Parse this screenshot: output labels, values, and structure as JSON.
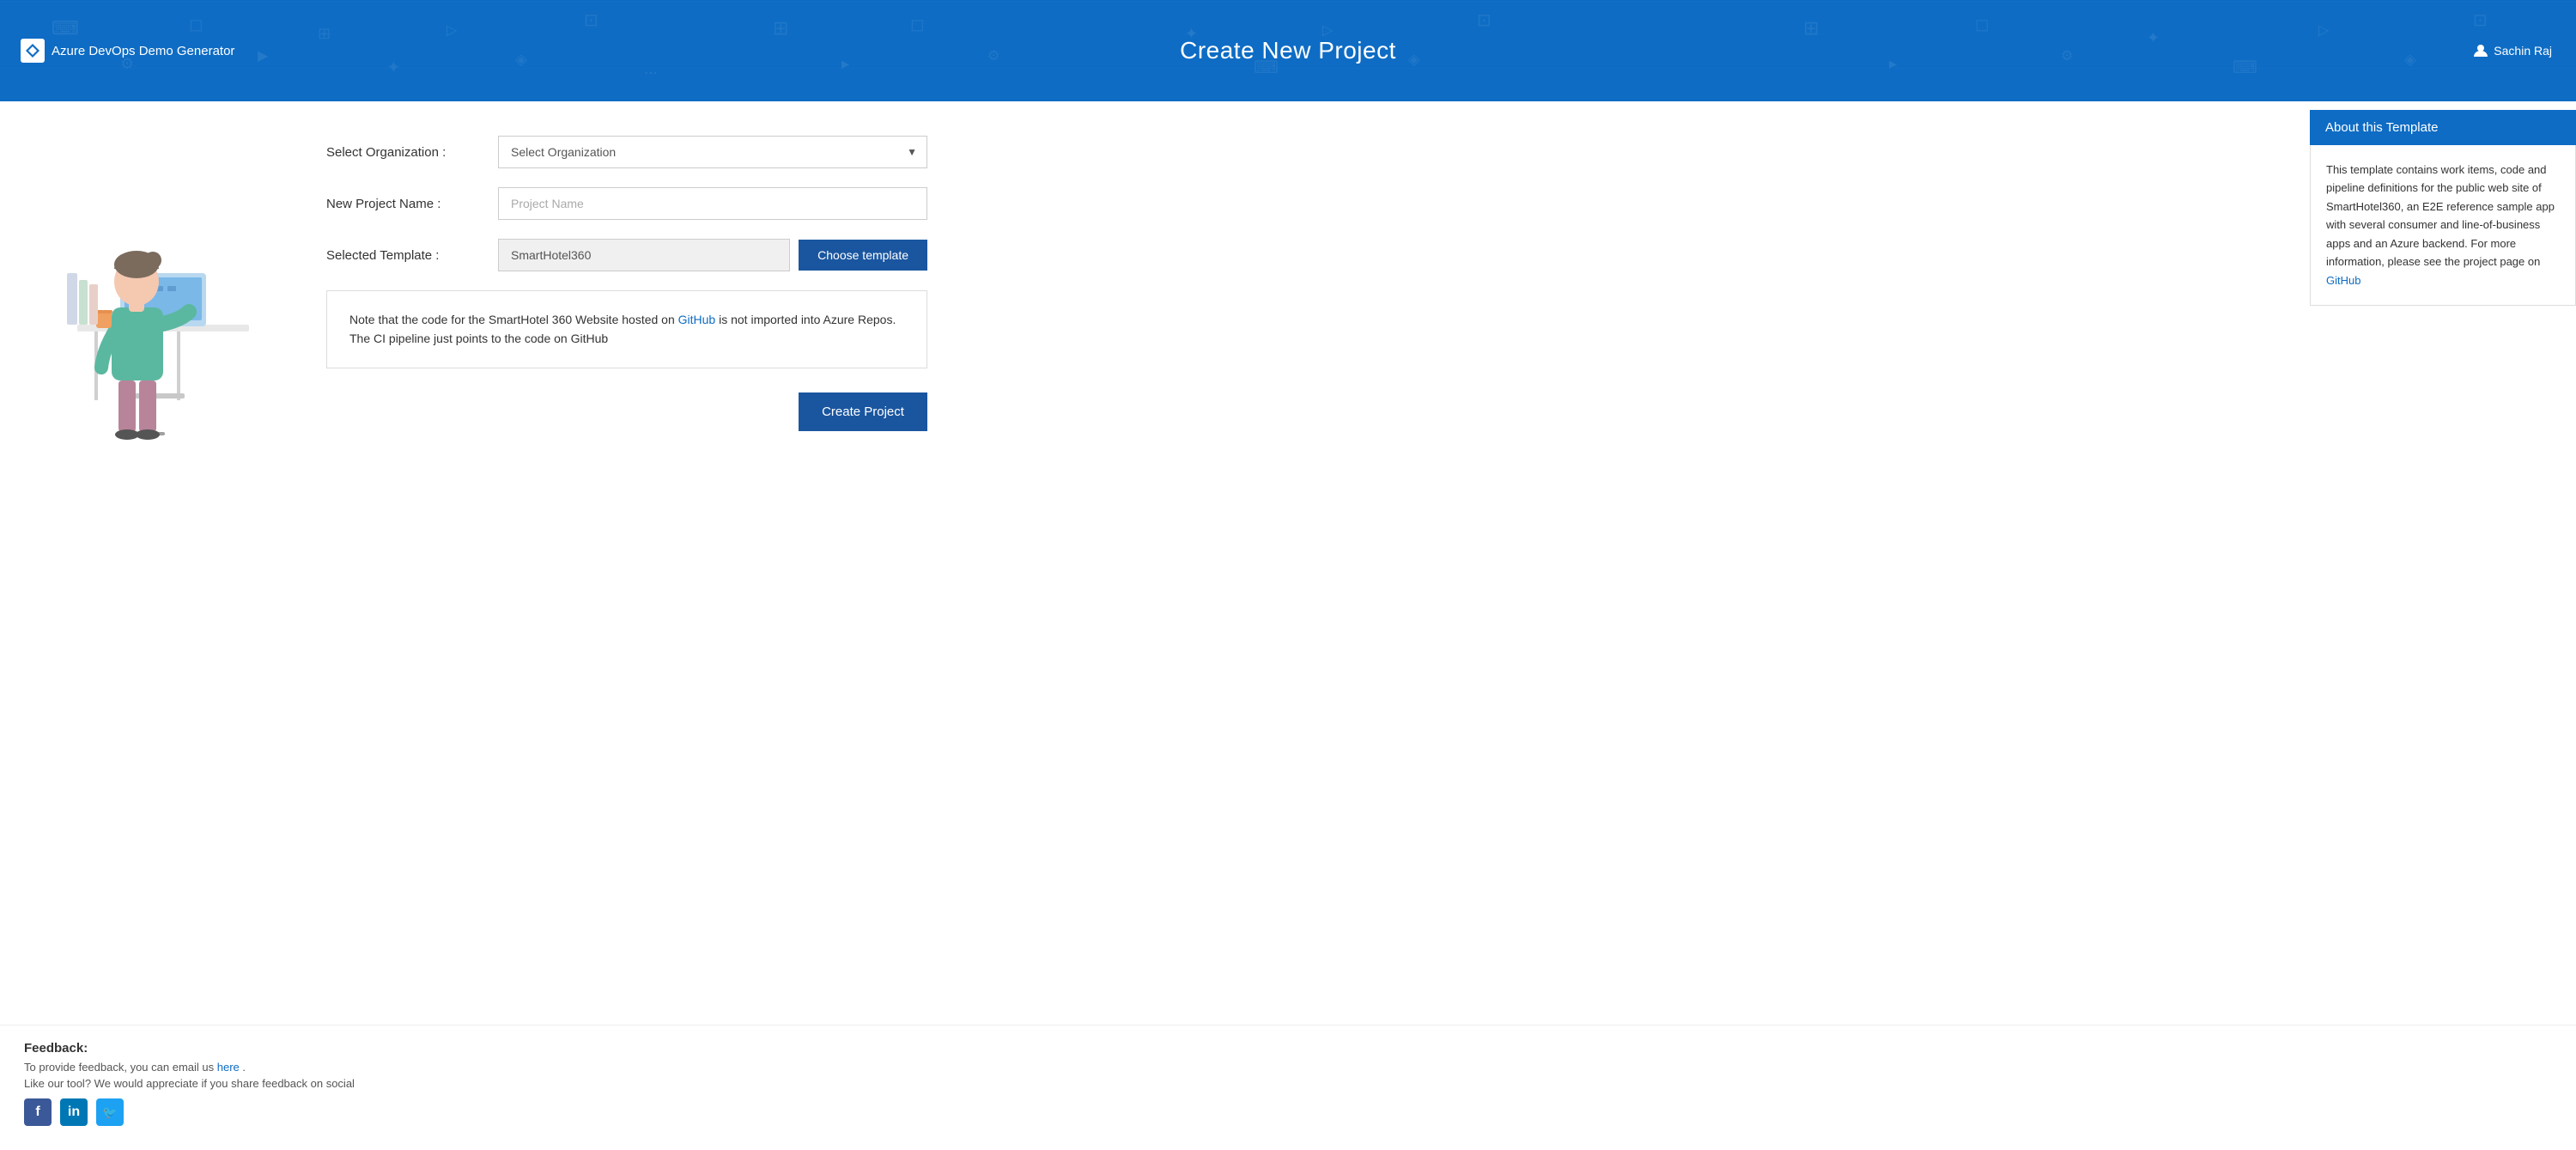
{
  "header": {
    "logo_label": "Azure DevOps Demo Generator",
    "title": "Create New Project",
    "user": "Sachin Raj"
  },
  "form": {
    "org_label": "Select Organization :",
    "org_placeholder": "Select Organization",
    "org_options": [
      "Select Organization"
    ],
    "project_name_label": "New Project Name :",
    "project_name_placeholder": "Project Name",
    "selected_template_label": "Selected Template :",
    "template_value": "SmartHotel360",
    "choose_template_btn": "Choose template",
    "info_text_before_link": "Note that the code for the SmartHotel 360 Website hosted on ",
    "info_link_text": "GitHub",
    "info_link_href": "#",
    "info_text_after_link": " is not imported into Azure Repos. The CI pipeline just points to the code on GitHub",
    "create_project_btn": "Create Project"
  },
  "sidebar": {
    "about_title": "About this Template",
    "about_text_1": "This template contains work items, code and pipeline definitions for the public web site of SmartHotel360, an E2E reference sample app with several consumer and line-of-business apps and an Azure backend. For more information, please see the project page on ",
    "about_link_text": "GitHub",
    "about_link_href": "#"
  },
  "footer": {
    "feedback_title": "Feedback:",
    "feedback_line1_before": "To provide feedback, you can email us ",
    "feedback_link_text": "here",
    "feedback_line1_after": " .",
    "feedback_line2": "Like our tool? We would appreciate if you share feedback on social",
    "social": {
      "facebook": "f",
      "linkedin": "in",
      "twitter": "🐦"
    }
  }
}
